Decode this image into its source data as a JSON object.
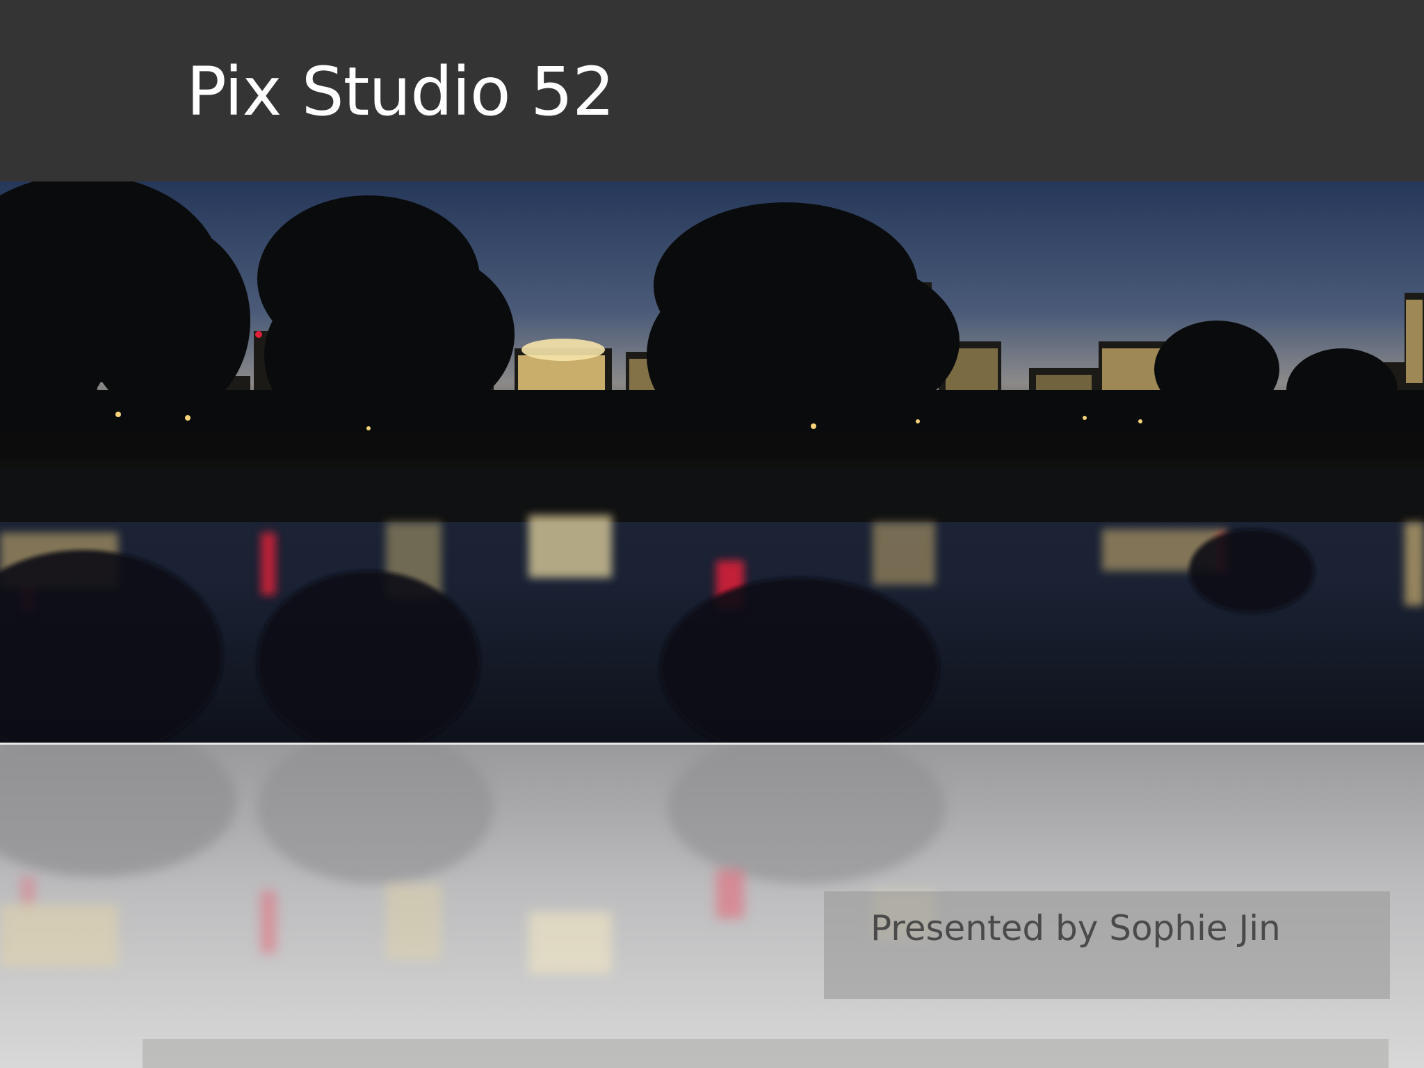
{
  "slide": {
    "title": "Pix Studio 52",
    "subtitle": "Presented by Sophie Jin"
  },
  "photo": {
    "subject": "night-city-skyline-reflection",
    "colors": {
      "sky_top": "#2b3c5e",
      "sky_horizon": "#8a8a8c",
      "water": "#141b2a",
      "light_warm": "#f3d98a",
      "light_red": "#e0203a"
    }
  },
  "theme": {
    "title_bar": "#343434",
    "title_text": "#ffffff",
    "subtitle_text": "#4a4a4a"
  }
}
